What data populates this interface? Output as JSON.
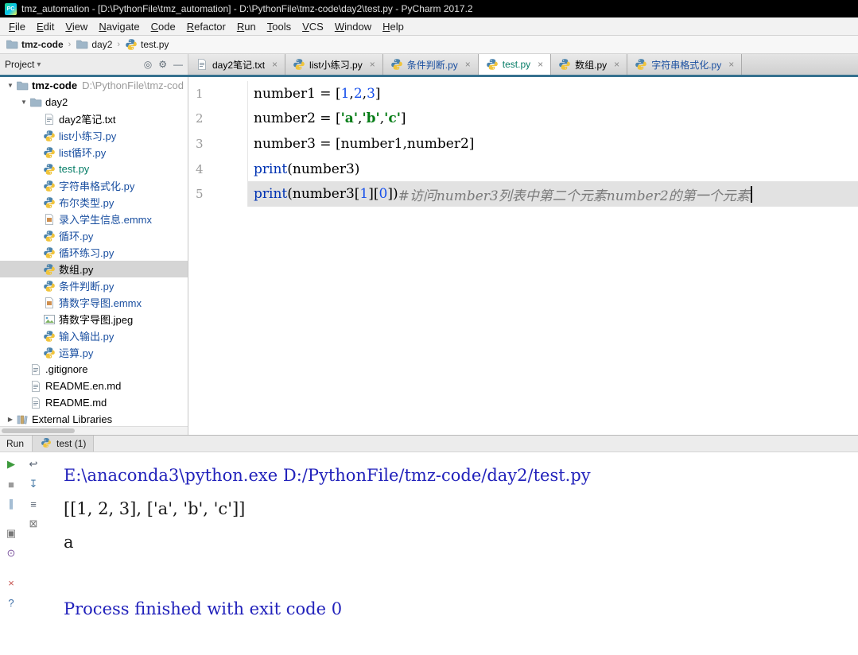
{
  "title_bar": {
    "title": "tmz_automation - [D:\\PythonFile\\tmz_automation] - D:\\PythonFile\\tmz-code\\day2\\test.py - PyCharm 2017.2",
    "logo_text": "PC"
  },
  "menu_bar": {
    "items": [
      "File",
      "Edit",
      "View",
      "Navigate",
      "Code",
      "Refactor",
      "Run",
      "Tools",
      "VCS",
      "Window",
      "Help"
    ]
  },
  "nav_bar": {
    "breadcrumbs": [
      {
        "label": "tmz-code",
        "icon": "folder",
        "bold": true
      },
      {
        "label": "day2",
        "icon": "folder",
        "bold": false
      },
      {
        "label": "test.py",
        "icon": "python",
        "bold": false
      }
    ]
  },
  "project_panel": {
    "title": "Project",
    "header_icons": [
      {
        "name": "locate-file-button",
        "glyph": "◎"
      },
      {
        "name": "settings-gear-button",
        "glyph": "⚙"
      },
      {
        "name": "hide-panel-button",
        "glyph": "—"
      }
    ],
    "tree": [
      {
        "label": "tmz-code",
        "path": "D:\\PythonFile\\tmz-cod",
        "indent": 0,
        "icon": "folder",
        "chevron": "down",
        "bold": true,
        "color": "#000000"
      },
      {
        "label": "day2",
        "indent": 1,
        "icon": "folder",
        "chevron": "down",
        "color": "#000000"
      },
      {
        "label": "day2笔记.txt",
        "indent": 2,
        "icon": "text",
        "color": "#000000"
      },
      {
        "label": "list小练习.py",
        "indent": 2,
        "icon": "python",
        "color": "#1A4FA0"
      },
      {
        "label": "list循环.py",
        "indent": 2,
        "icon": "python",
        "color": "#1A4FA0"
      },
      {
        "label": "test.py",
        "indent": 2,
        "icon": "python",
        "color": "#067D67"
      },
      {
        "label": "字符串格式化.py",
        "indent": 2,
        "icon": "python",
        "color": "#1A4FA0"
      },
      {
        "label": "布尔类型.py",
        "indent": 2,
        "icon": "python",
        "color": "#1A4FA0"
      },
      {
        "label": "录入学生信息.emmx",
        "indent": 2,
        "icon": "file",
        "color": "#1A4FA0"
      },
      {
        "label": "循环.py",
        "indent": 2,
        "icon": "python",
        "color": "#1A4FA0"
      },
      {
        "label": "循环练习.py",
        "indent": 2,
        "icon": "python",
        "color": "#1A4FA0"
      },
      {
        "label": "数组.py",
        "indent": 2,
        "icon": "python",
        "color": "#000000",
        "selected": true
      },
      {
        "label": "条件判断.py",
        "indent": 2,
        "icon": "python",
        "color": "#1A4FA0"
      },
      {
        "label": "猜数字导图.emmx",
        "indent": 2,
        "icon": "file",
        "color": "#1A4FA0"
      },
      {
        "label": "猜数字导图.jpeg",
        "indent": 2,
        "icon": "image",
        "color": "#000000"
      },
      {
        "label": "输入输出.py",
        "indent": 2,
        "icon": "python",
        "color": "#1A4FA0"
      },
      {
        "label": "运算.py",
        "indent": 2,
        "icon": "python",
        "color": "#1A4FA0"
      },
      {
        "label": ".gitignore",
        "indent": 1,
        "icon": "text",
        "color": "#000000"
      },
      {
        "label": "README.en.md",
        "indent": 1,
        "icon": "text",
        "color": "#000000"
      },
      {
        "label": "README.md",
        "indent": 1,
        "icon": "text",
        "color": "#000000"
      },
      {
        "label": "External Libraries",
        "indent": 0,
        "icon": "library",
        "chevron": "right",
        "color": "#000000"
      }
    ]
  },
  "editor": {
    "tabs": [
      {
        "label": "day2笔记.txt",
        "icon": "text",
        "color": "#000000"
      },
      {
        "label": "list小练习.py",
        "icon": "python",
        "color": "#000000"
      },
      {
        "label": "条件判断.py",
        "icon": "python",
        "color": "#1A4FA0"
      },
      {
        "label": "test.py",
        "icon": "python",
        "color": "#067D67",
        "active": true
      },
      {
        "label": "数组.py",
        "icon": "python",
        "color": "#000000"
      },
      {
        "label": "字符串格式化.py",
        "icon": "python",
        "color": "#1A4FA0"
      }
    ],
    "token_colors": {
      "plain": "#000000",
      "num": "#1750EB",
      "str": "#067D17",
      "kw": "#0033B3",
      "comment": "#7A7A7A"
    },
    "lines": [
      {
        "num": "1",
        "tokens": [
          {
            "t": "number1 = ["
          },
          {
            "t": "1",
            "c": "num"
          },
          {
            "t": ","
          },
          {
            "t": "2",
            "c": "num"
          },
          {
            "t": ","
          },
          {
            "t": "3",
            "c": "num"
          },
          {
            "t": "]"
          }
        ]
      },
      {
        "num": "2",
        "tokens": [
          {
            "t": "number2 = ["
          },
          {
            "t": "'a'",
            "c": "str"
          },
          {
            "t": ","
          },
          {
            "t": "'b'",
            "c": "str"
          },
          {
            "t": ","
          },
          {
            "t": "'c'",
            "c": "str"
          },
          {
            "t": "]"
          }
        ]
      },
      {
        "num": "3",
        "tokens": [
          {
            "t": "number3 = [number1,number2]"
          }
        ]
      },
      {
        "num": "4",
        "tokens": [
          {
            "t": "print",
            "c": "kw"
          },
          {
            "t": "(number3)"
          }
        ]
      },
      {
        "num": "5",
        "current": true,
        "caret": true,
        "tokens": [
          {
            "t": "print",
            "c": "kw"
          },
          {
            "t": "(number3["
          },
          {
            "t": "1",
            "c": "num"
          },
          {
            "t": "]["
          },
          {
            "t": "0",
            "c": "num"
          },
          {
            "t": "])"
          },
          {
            "t": "#访问number3列表中第二个元素number2的第一个元素",
            "c": "comment"
          }
        ]
      }
    ]
  },
  "run_panel": {
    "label": "Run",
    "tab": {
      "label": "test (1)",
      "icon": "python"
    },
    "toolbar_main": [
      {
        "name": "rerun-button",
        "glyph": "▶",
        "color": "#3C9A3C"
      },
      {
        "name": "stop-button",
        "glyph": "■",
        "color": "#9B9B9B"
      },
      {
        "name": "pause-output-button",
        "glyph": "∥",
        "color": "#4A7CA8"
      },
      {
        "name": "restore-layout-button",
        "glyph": "▣",
        "color": "#777777",
        "gap": true
      },
      {
        "name": "pin-tab-button",
        "glyph": "⊙",
        "color": "#7E57A0"
      },
      {
        "name": "close-button",
        "glyph": "×",
        "color": "#C75450",
        "gap": true
      },
      {
        "name": "help-button",
        "glyph": "?",
        "color": "#3669A3"
      }
    ],
    "toolbar_console": [
      {
        "name": "soft-wrap-button",
        "glyph": "↩",
        "color": "#556070"
      },
      {
        "name": "scroll-to-end-button",
        "glyph": "↧",
        "color": "#4A7CA8"
      },
      {
        "name": "print-button",
        "glyph": "≡",
        "color": "#556070"
      },
      {
        "name": "clear-console-button",
        "glyph": "⊠",
        "color": "#777777"
      }
    ],
    "console_colors": {
      "system": "#2222BB",
      "stdout": "#1A1A1A"
    },
    "console_lines": [
      {
        "text": "E:\\anaconda3\\python.exe D:/PythonFile/tmz-code/day2/test.py",
        "type": "system"
      },
      {
        "text": "[[1, 2, 3], ['a', 'b', 'c']]",
        "type": "stdout"
      },
      {
        "text": "a",
        "type": "stdout"
      },
      {
        "text": "",
        "type": "stdout"
      },
      {
        "text": "Process finished with exit code 0",
        "type": "system"
      }
    ]
  },
  "ui_colors": {
    "content_divider_strip": "#36718F",
    "tree_selection": "#D5D5D5",
    "current_line": "#E2E2E2"
  }
}
